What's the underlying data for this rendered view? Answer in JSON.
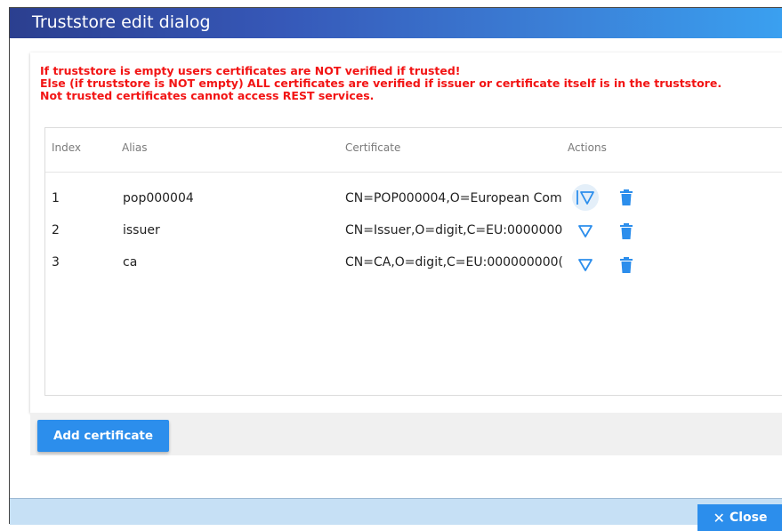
{
  "dialog": {
    "title": "Truststore edit dialog"
  },
  "warning": {
    "lines": [
      "If truststore is empty users certificates are NOT verified if trusted!",
      "Else (if truststore is NOT empty) ALL certificates are verified if issuer or certificate itself is in the truststore.",
      "Not trusted certificates cannot access REST services."
    ]
  },
  "table": {
    "headers": {
      "index": "Index",
      "alias": "Alias",
      "certificate": "Certificate",
      "actions": "Actions"
    },
    "rows": [
      {
        "index": "1",
        "alias": "pop000004",
        "certificate": "CN=POP000004,O=European Com"
      },
      {
        "index": "2",
        "alias": "issuer",
        "certificate": "CN=Issuer,O=digit,C=EU:0000000"
      },
      {
        "index": "3",
        "alias": "ca",
        "certificate": "CN=CA,O=digit,C=EU:000000000("
      }
    ]
  },
  "buttons": {
    "add_certificate": "Add certificate",
    "close": "Close"
  },
  "colors": {
    "accent": "#2c8eec",
    "warning": "#f21414",
    "titlebar_start": "#2b3f8f",
    "titlebar_end": "#3aa0f0"
  },
  "icons": {
    "details": "triangle-down-icon",
    "delete": "trash-icon",
    "close": "close-icon"
  }
}
